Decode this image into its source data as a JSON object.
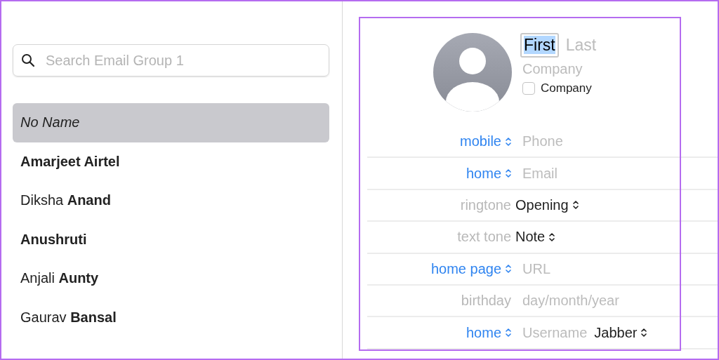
{
  "search": {
    "placeholder": "Search Email Group 1"
  },
  "contacts": [
    {
      "name": "No Name",
      "kind": "unnamed",
      "selected": true
    },
    {
      "name": "**Amarjeet Airtel**",
      "kind": "named",
      "selected": false
    },
    {
      "name": "Diksha **Anand**",
      "kind": "named",
      "selected": false
    },
    {
      "name": "**Anushruti**",
      "kind": "named",
      "selected": false
    },
    {
      "name": "Anjali **Aunty**",
      "kind": "named",
      "selected": false
    },
    {
      "name": "Gaurav **Bansal**",
      "kind": "named",
      "selected": false
    }
  ],
  "card": {
    "first": {
      "text": "First",
      "selected": true
    },
    "last": {
      "placeholder": "Last"
    },
    "company": {
      "placeholder": "Company"
    },
    "company_checkbox": {
      "label": "Company",
      "checked": false
    },
    "fields": [
      {
        "label": "mobile",
        "kind": "picker",
        "placeholder": "Phone"
      },
      {
        "label": "home",
        "kind": "picker",
        "placeholder": "Email"
      },
      {
        "label": "ringtone",
        "kind": "plain",
        "value": "Opening"
      },
      {
        "label": "text tone",
        "kind": "plain",
        "value": "Note"
      },
      {
        "label": "home page",
        "kind": "picker",
        "placeholder": "URL"
      },
      {
        "label": "birthday",
        "kind": "plain",
        "placeholder": "day/month/year"
      },
      {
        "label": "home",
        "kind": "picker",
        "placeholder": "Username",
        "value": "Jabber"
      }
    ]
  }
}
